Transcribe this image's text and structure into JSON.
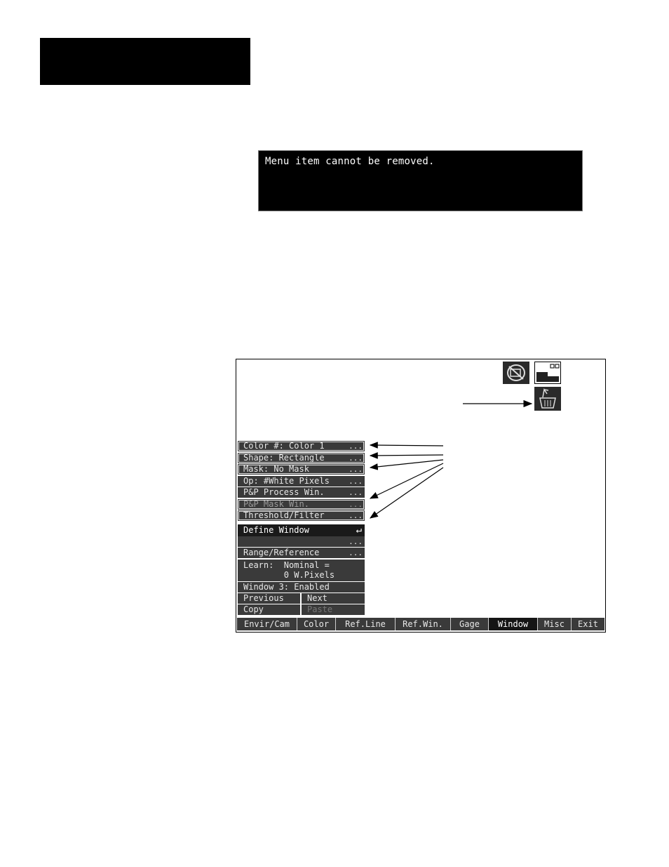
{
  "message": "Menu item cannot be removed.",
  "screen": {
    "icons": [
      "no-camera-icon",
      "window-layout-icon",
      "trash-basket-icon"
    ],
    "menu": [
      {
        "label": "Color #: Color 1",
        "suffix": "...",
        "boxed": true
      },
      {
        "label": "Shape: Rectangle",
        "suffix": "...",
        "boxed": true
      },
      {
        "label": "Mask: No Mask",
        "suffix": "...",
        "boxed": true
      },
      {
        "label": "Op: #White Pixels",
        "suffix": "..."
      },
      {
        "label": "P&P Process Win.",
        "suffix": "..."
      },
      {
        "label": "P&P Mask Win.",
        "suffix": "...",
        "dim": true,
        "boxed": true
      },
      {
        "label": "Threshold/Filter",
        "suffix": "...",
        "boxed": true
      },
      {
        "label": "Define Window",
        "suffix": "↵",
        "selected": true
      },
      {
        "label": "",
        "suffix": "..."
      },
      {
        "label": "Range/Reference",
        "suffix": "..."
      },
      {
        "label": "Learn:  Nominal =\n        0 W.Pixels",
        "suffix": ""
      },
      {
        "label": "Window 3: Enabled",
        "suffix": ""
      }
    ],
    "nav_buttons": {
      "previous": "Previous",
      "next": "Next",
      "copy": "Copy",
      "paste": "Paste"
    },
    "tabs": [
      "Envir/Cam",
      "Color",
      "Ref.Line",
      "Ref.Win.",
      "Gage",
      "Window",
      "Misc",
      "Exit"
    ],
    "active_tab": "Window"
  }
}
